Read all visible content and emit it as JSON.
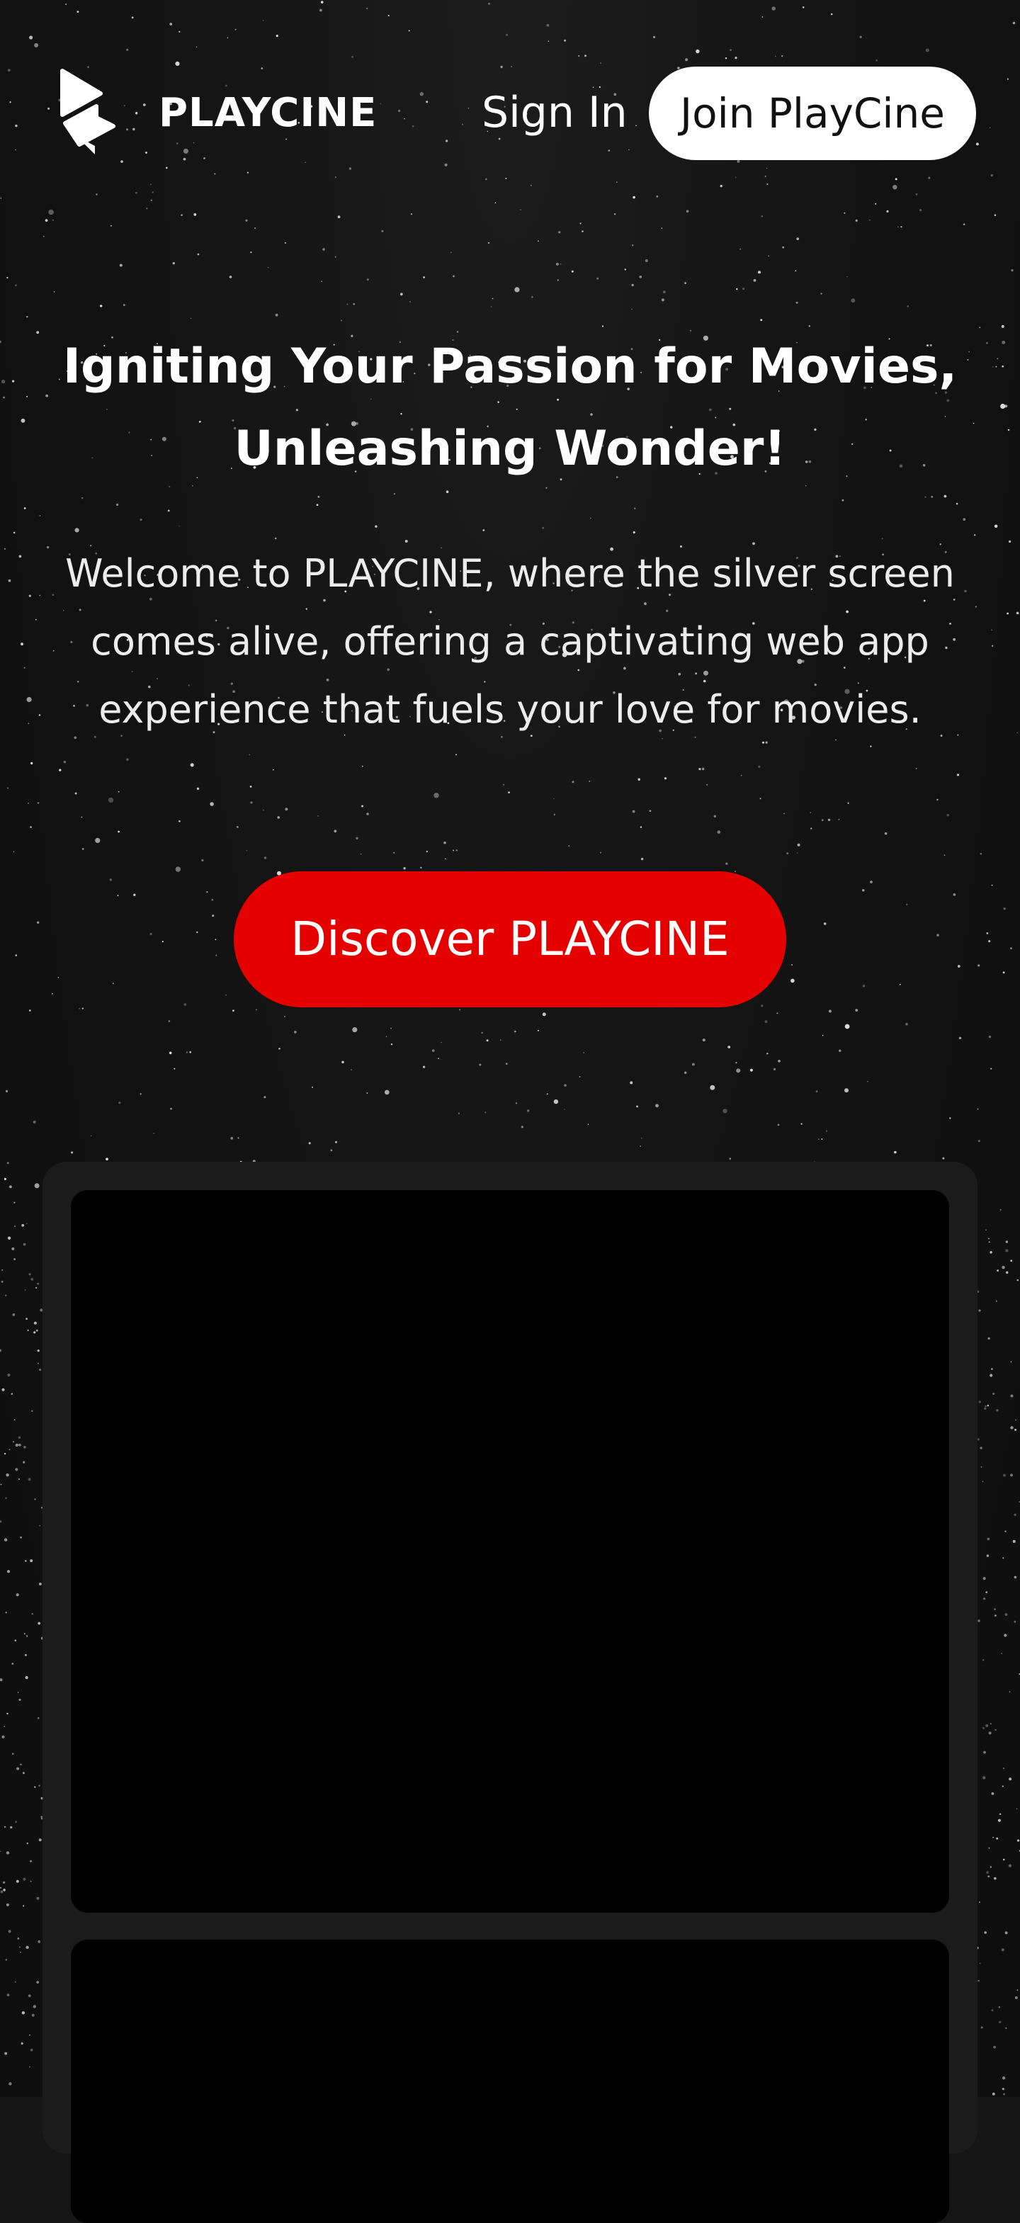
{
  "brand": {
    "name": "PLAYCINE",
    "logo_icon": "play-triangle-logo"
  },
  "nav": {
    "sign_in_label": "Sign In",
    "join_label": "Join PlayCine"
  },
  "hero": {
    "title_line1": "Igniting Your Passion for Movies,",
    "title_line2": "Unleashing Wonder!",
    "subtitle": "Welcome to PLAYCINE, where the silver screen comes alive, offering a captivating web app experience that fuels your love for movies.",
    "cta_label": "Discover PLAYCINE"
  },
  "colors": {
    "accent_red": "#e50000",
    "background": "#121212",
    "panel": "#1b1b1b",
    "media": "#000000",
    "button_light": "#ffffff"
  }
}
